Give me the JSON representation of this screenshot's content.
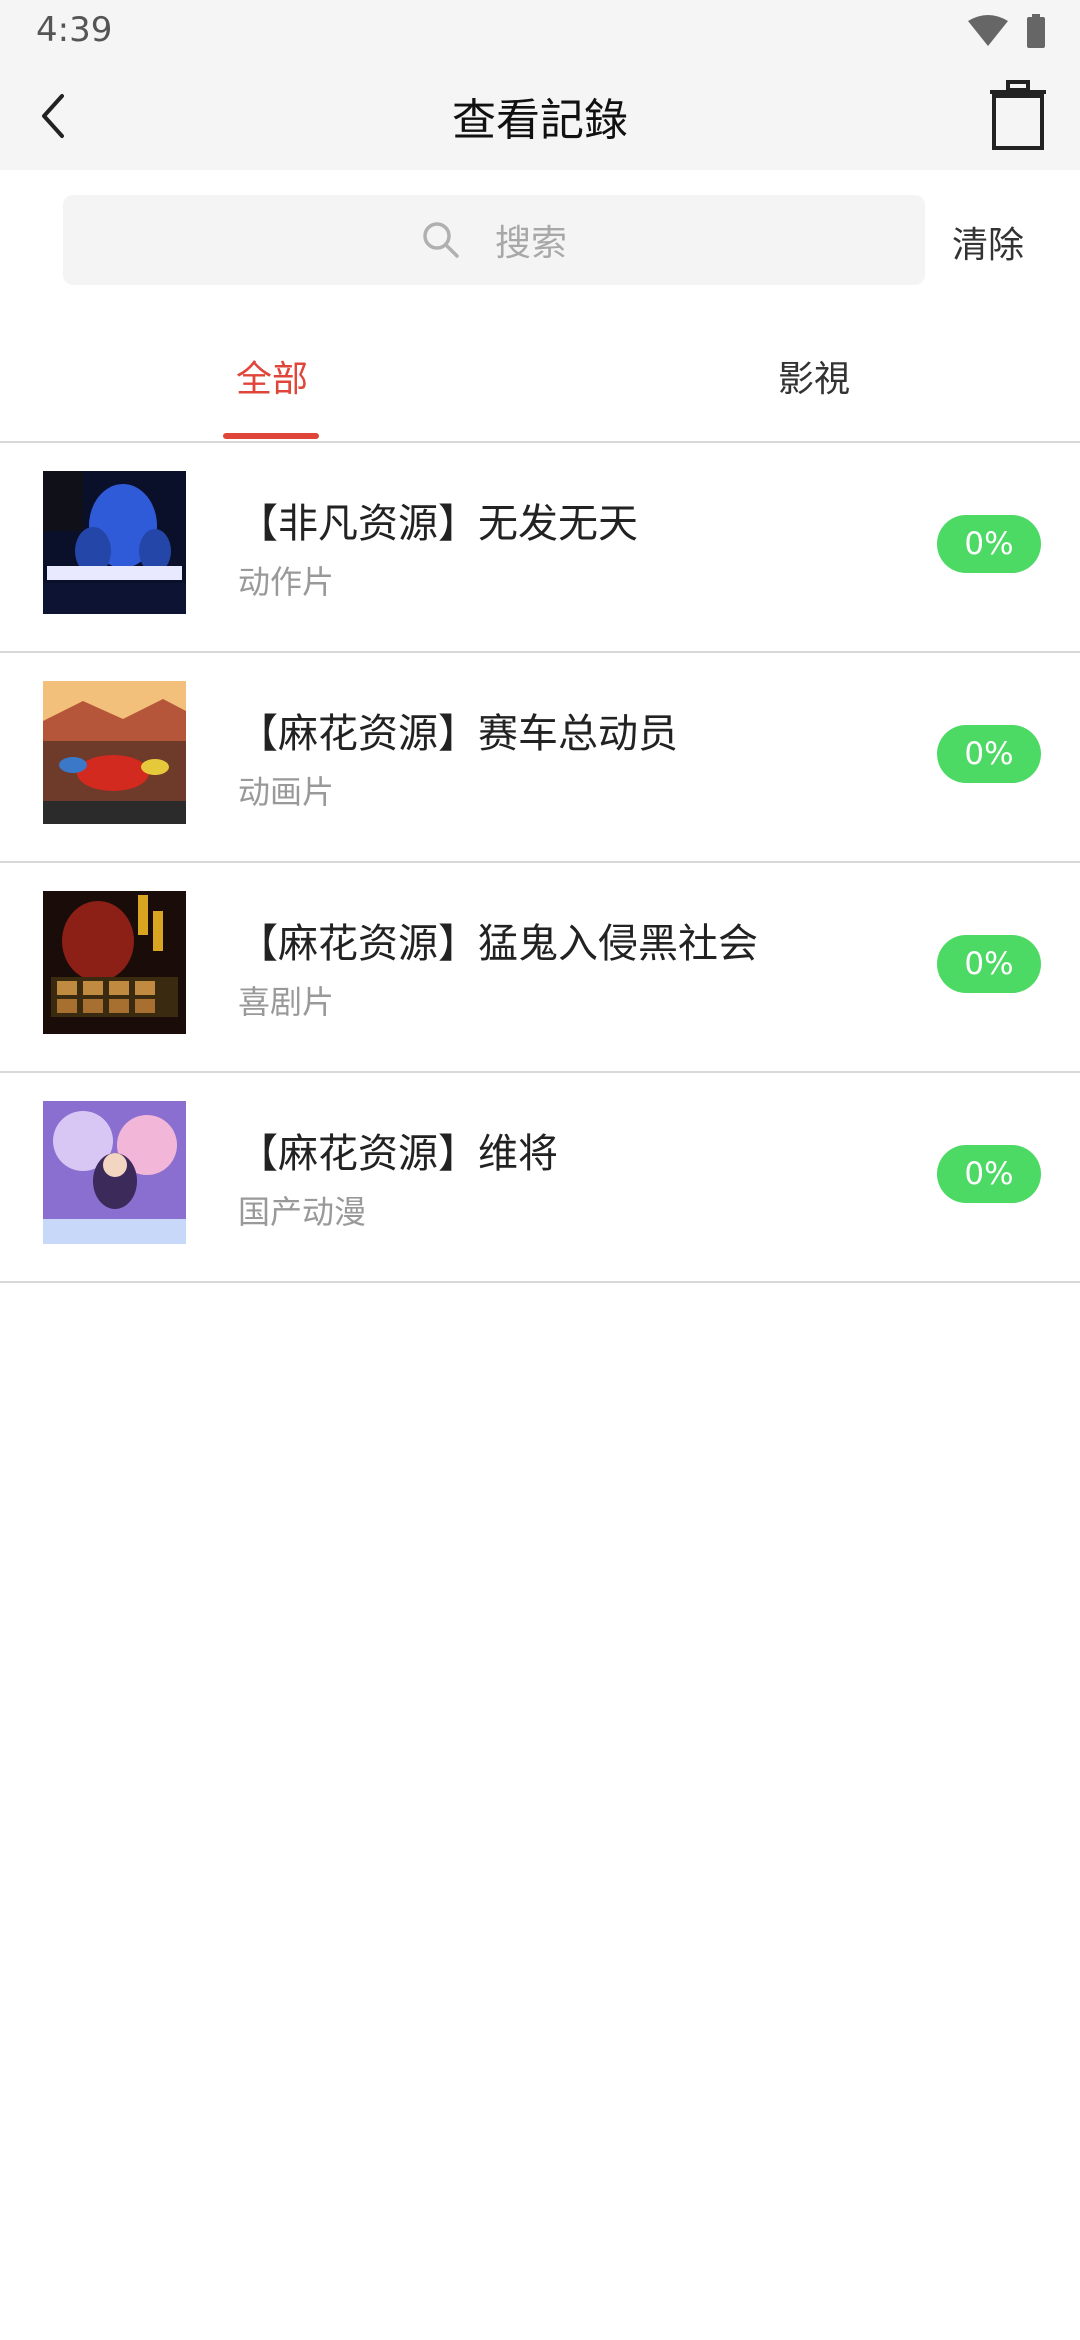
{
  "status_bar": {
    "time": "4:39",
    "icons": [
      "wifi-icon",
      "battery-icon"
    ]
  },
  "header": {
    "title": "查看記錄",
    "back_icon": "back-arrow-icon",
    "trash_icon": "trash-icon"
  },
  "search": {
    "placeholder": "搜索",
    "clear_label": "清除"
  },
  "tabs": [
    {
      "label": "全部",
      "active": true
    },
    {
      "label": "影視",
      "active": false
    }
  ],
  "history": [
    {
      "title": "【非凡资源】无发无天",
      "category": "动作片",
      "progress": "0%"
    },
    {
      "title": "【麻花资源】赛车总动员",
      "category": "动画片",
      "progress": "0%"
    },
    {
      "title": "【麻花资源】猛鬼入侵黑社会",
      "category": "喜剧片",
      "progress": "0%"
    },
    {
      "title": "【麻花资源】维将",
      "category": "国产动漫",
      "progress": "0%"
    }
  ],
  "colors": {
    "accent": "#e0453a",
    "progress_badge": "#4cd964",
    "header_bg": "#f5f5f5"
  }
}
